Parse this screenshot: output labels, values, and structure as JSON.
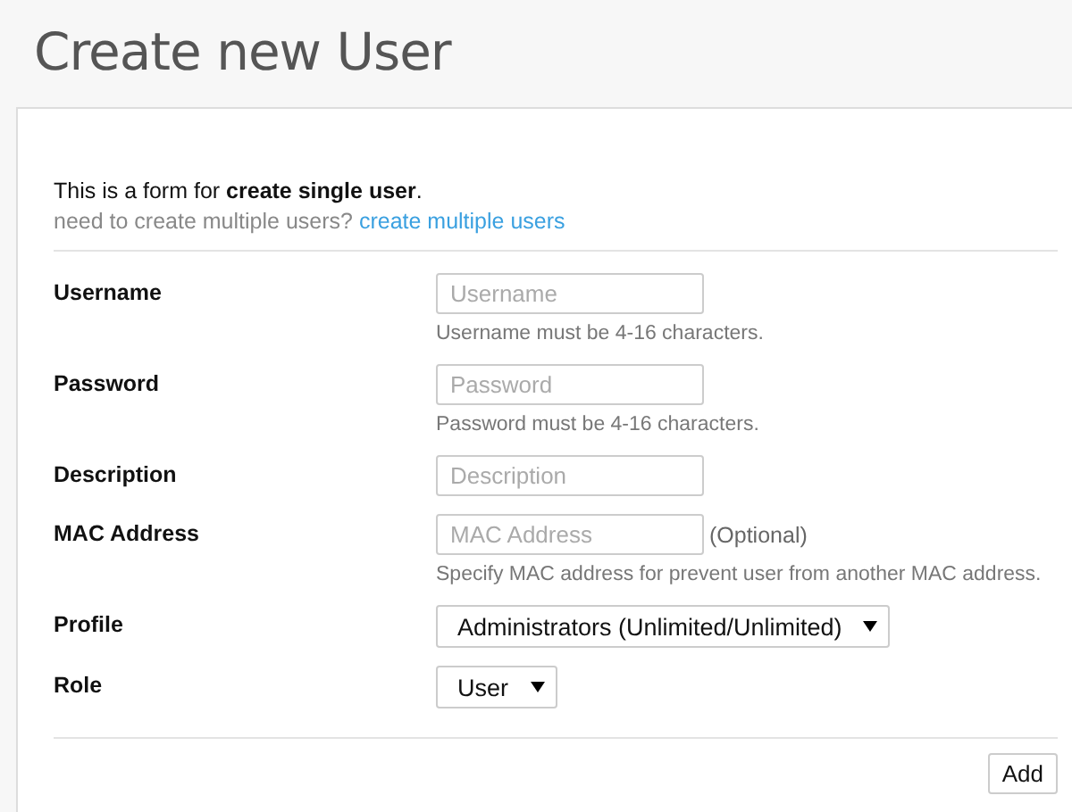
{
  "page_title": "Create new User",
  "intro": {
    "text": "This is a form for **create single user**.",
    "question": "need to create multiple users?",
    "link": "create multiple users"
  },
  "fields": [
    {
      "kind": "text",
      "label": "Username",
      "placeholder": "Username",
      "help": "Username must be 4-16 characters."
    },
    {
      "kind": "text",
      "label": "Password",
      "placeholder": "Password",
      "help": "Password must be 4-16 characters."
    },
    {
      "kind": "text",
      "label": "Description",
      "placeholder": "Description"
    },
    {
      "kind": "text",
      "label": "MAC Address",
      "placeholder": "MAC Address",
      "suffix": "(Optional)",
      "help": "Specify MAC address for prevent user from another MAC address."
    },
    {
      "kind": "select",
      "label": "Profile",
      "value": "Administrators (Unlimited/Unlimited)"
    },
    {
      "kind": "select",
      "label": "Role",
      "value": "User"
    }
  ],
  "submit": "Add"
}
